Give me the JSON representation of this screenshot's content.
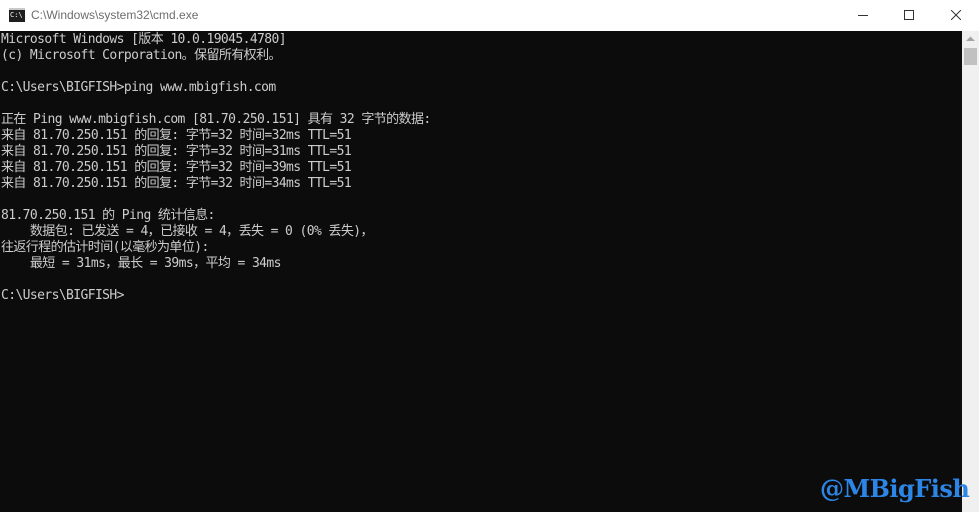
{
  "window": {
    "title": "C:\\Windows\\system32\\cmd.exe",
    "app_icon": "cmd-console-icon",
    "controls": {
      "minimize_icon": "minimize-icon",
      "maximize_icon": "maximize-icon",
      "close_icon": "close-icon"
    }
  },
  "console": {
    "background": "#0c0c0c",
    "foreground": "#cccccc",
    "lines": [
      "Microsoft Windows [版本 10.0.19045.4780]",
      "(c) Microsoft Corporation。保留所有权利。",
      "",
      "C:\\Users\\BIGFISH>ping www.mbigfish.com",
      "",
      "正在 Ping www.mbigfish.com [81.70.250.151] 具有 32 字节的数据:",
      "来自 81.70.250.151 的回复: 字节=32 时间=32ms TTL=51",
      "来自 81.70.250.151 的回复: 字节=32 时间=31ms TTL=51",
      "来自 81.70.250.151 的回复: 字节=32 时间=39ms TTL=51",
      "来自 81.70.250.151 的回复: 字节=32 时间=34ms TTL=51",
      "",
      "81.70.250.151 的 Ping 统计信息:",
      "    数据包: 已发送 = 4，已接收 = 4，丢失 = 0 (0% 丢失)，",
      "往返行程的估计时间(以毫秒为单位):",
      "    最短 = 31ms，最长 = 39ms，平均 = 34ms",
      "",
      "C:\\Users\\BIGFISH>"
    ]
  },
  "scrollbar": {
    "up_arrow_icon": "scroll-up-arrow-icon"
  },
  "watermark": {
    "text": "@MBigFish",
    "color": "#2d86e6"
  }
}
